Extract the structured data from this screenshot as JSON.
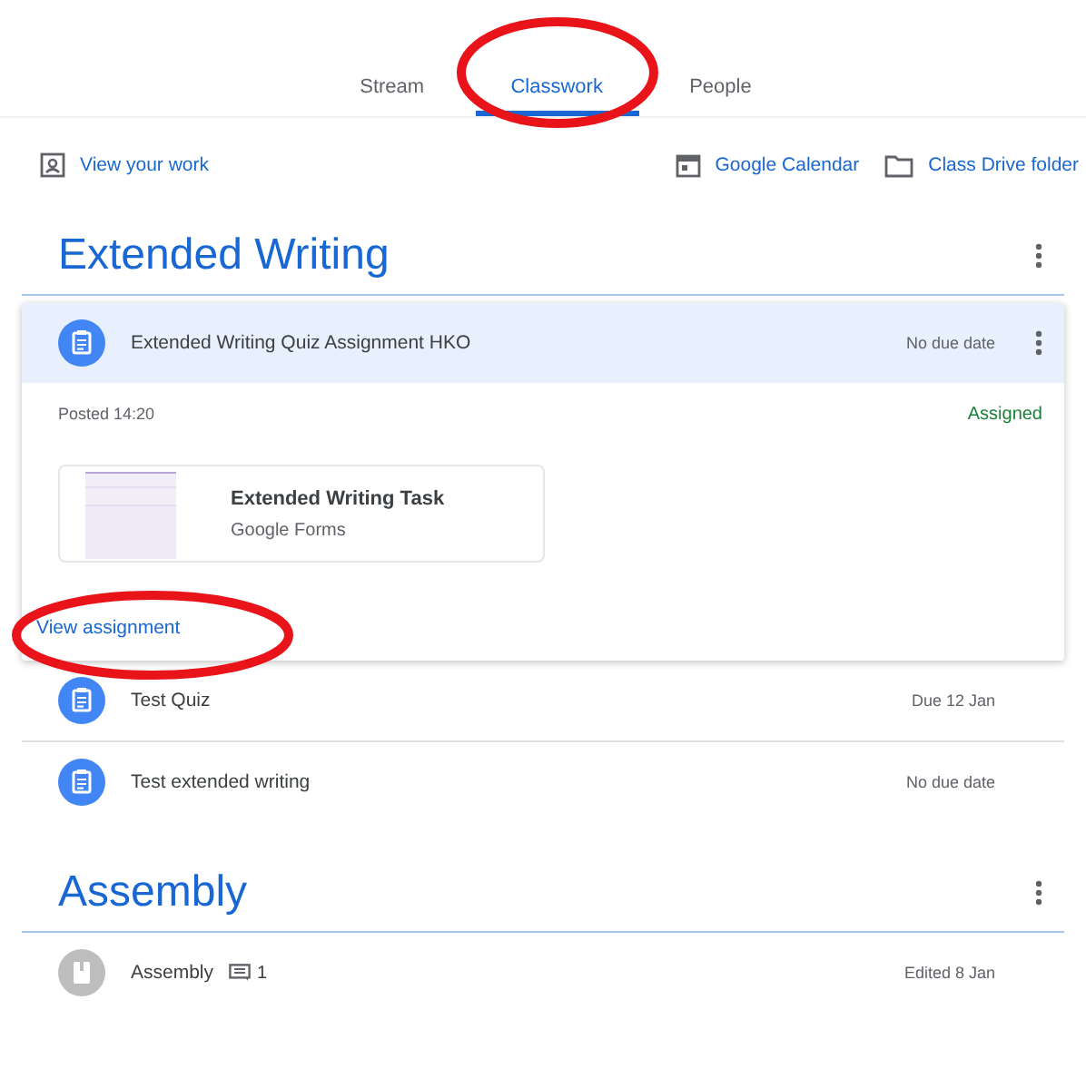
{
  "tabs": [
    {
      "label": "Stream",
      "selected": false,
      "circled": false
    },
    {
      "label": "Classwork",
      "selected": true,
      "circled": true
    },
    {
      "label": "People",
      "selected": false,
      "circled": false
    }
  ],
  "toolbar": {
    "view_work": "View your work",
    "links": [
      {
        "label": "Google Calendar",
        "kind": "calendar"
      },
      {
        "label": "Class Drive folder",
        "kind": "folder"
      }
    ]
  },
  "topics": [
    {
      "title": "Extended Writing",
      "items": [
        {
          "title": "Extended Writing Quiz Assignment HKO",
          "due": "No due date",
          "expanded": true,
          "kind": "assignment",
          "posted": "Posted 14:20",
          "status": "Assigned",
          "attachment": {
            "title": "Extended Writing Task",
            "source": "Google Forms"
          },
          "link": {
            "label": "View assignment",
            "circled": true
          }
        },
        {
          "title": "Test Quiz",
          "due": "Due 12 Jan",
          "expanded": false,
          "kind": "assignment"
        },
        {
          "title": "Test extended writing",
          "due": "No due date",
          "expanded": false,
          "kind": "assignment"
        }
      ]
    },
    {
      "title": "Assembly",
      "items": [
        {
          "title": "Assembly",
          "due": "Edited 8 Jan",
          "expanded": false,
          "kind": "material",
          "comments": "1"
        }
      ]
    }
  ]
}
